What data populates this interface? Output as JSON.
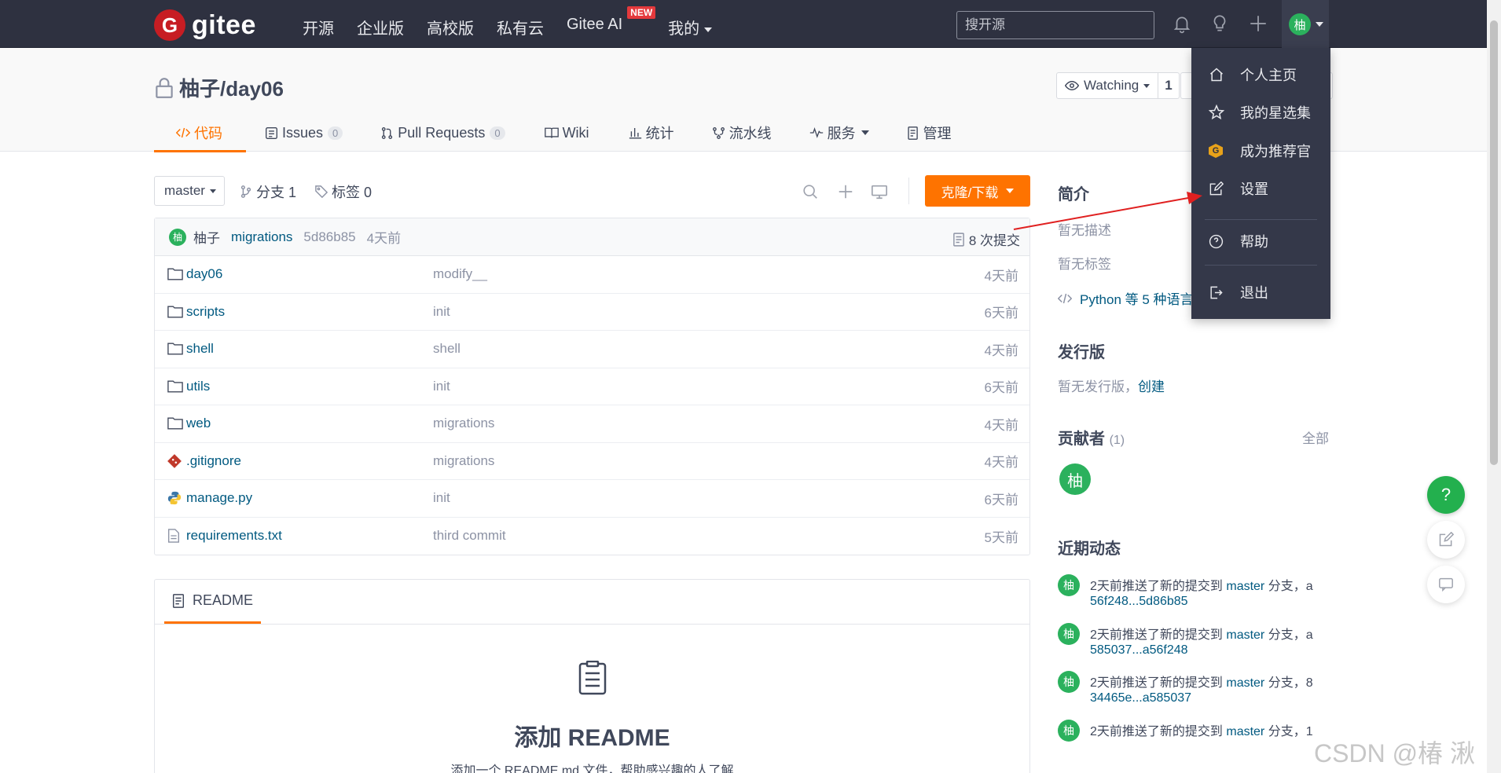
{
  "topnav": {
    "logo_letter": "G",
    "logo_text": "gitee",
    "links": [
      "开源",
      "企业版",
      "高校版",
      "私有云",
      "Gitee AI",
      "我的"
    ],
    "new_badge": "NEW",
    "search_placeholder": "搜开源",
    "avatar_char": "柚"
  },
  "repo": {
    "title": "柚子/day06",
    "watch_label": "Watching",
    "watch_count": "1"
  },
  "tabs": [
    {
      "label": "代码"
    },
    {
      "label": "Issues",
      "badge": "0"
    },
    {
      "label": "Pull Requests",
      "badge": "0"
    },
    {
      "label": "Wiki"
    },
    {
      "label": "统计"
    },
    {
      "label": "流水线"
    },
    {
      "label": "服务"
    },
    {
      "label": "管理"
    }
  ],
  "branch": {
    "current": "master",
    "branches": "分支 1",
    "tags": "标签 0",
    "clone_label": "克隆/下载"
  },
  "commit": {
    "avatar_char": "柚",
    "author": "柚子",
    "message": "migrations",
    "hash": "5d86b85",
    "time": "4天前",
    "count": "8 次提交"
  },
  "files": [
    {
      "name": "day06",
      "type": "folder",
      "message": "modify__",
      "time": "4天前"
    },
    {
      "name": "scripts",
      "type": "folder",
      "message": "init",
      "time": "6天前"
    },
    {
      "name": "shell",
      "type": "folder",
      "message": "shell",
      "time": "4天前"
    },
    {
      "name": "utils",
      "type": "folder",
      "message": "init",
      "time": "6天前"
    },
    {
      "name": "web",
      "type": "folder",
      "message": "migrations",
      "time": "4天前"
    },
    {
      "name": ".gitignore",
      "type": "git",
      "message": "migrations",
      "time": "4天前"
    },
    {
      "name": "manage.py",
      "type": "python",
      "message": "init",
      "time": "6天前"
    },
    {
      "name": "requirements.txt",
      "type": "text",
      "message": "third commit",
      "time": "5天前"
    }
  ],
  "readme": {
    "tab": "README",
    "title": "添加 README",
    "subtitle": "添加一个 README.md 文件，帮助感兴趣的人了解"
  },
  "sidebar": {
    "intro_title": "简介",
    "no_desc": "暂无描述",
    "no_tags": "暂无标签",
    "languages": "Python 等 5 种语言",
    "release_title": "发行版",
    "no_release": "暂无发行版，",
    "create": "创建",
    "contrib_title": "贡献者",
    "contrib_count": "(1)",
    "all": "全部",
    "contrib_avatar": "柚",
    "activity_title": "近期动态",
    "activities": [
      {
        "avatar": "柚",
        "prefix": "2天前推送了新的提交到 ",
        "branch": "master",
        "suffix": " 分支，a",
        "range": "56f248...5d86b85"
      },
      {
        "avatar": "柚",
        "prefix": "2天前推送了新的提交到 ",
        "branch": "master",
        "suffix": " 分支，a",
        "range": "585037...a56f248"
      },
      {
        "avatar": "柚",
        "prefix": "2天前推送了新的提交到 ",
        "branch": "master",
        "suffix": " 分支，8",
        "range": "34465e...a585037"
      },
      {
        "avatar": "柚",
        "prefix": "2天前推送了新的提交到 ",
        "branch": "master",
        "suffix": " 分支，1",
        "range": ""
      }
    ]
  },
  "dropdown": {
    "items": [
      "个人主页",
      "我的星选集",
      "成为推荐官",
      "设置",
      "帮助",
      "退出"
    ],
    "recommend_icon_letter": "G"
  },
  "fab": {
    "help": "?"
  },
  "watermark": "CSDN @椿  湫",
  "colors": {
    "nav_bg": "#2e3140",
    "accent": "#fe7300",
    "link": "#005980",
    "avatar_green": "#2bb15d",
    "arrow_red": "#e02020"
  }
}
